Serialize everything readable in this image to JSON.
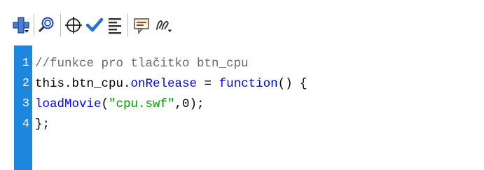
{
  "toolbar": {
    "buttons": [
      {
        "id": "add",
        "icon": "add-statement-icon"
      },
      {
        "id": "find",
        "icon": "find-icon"
      },
      {
        "id": "target",
        "icon": "insert-target-path-icon"
      },
      {
        "id": "check",
        "icon": "check-syntax-icon"
      },
      {
        "id": "format",
        "icon": "auto-format-icon"
      },
      {
        "id": "codehint",
        "icon": "code-hint-icon"
      },
      {
        "id": "debug",
        "icon": "debug-options-icon"
      }
    ]
  },
  "editor": {
    "lines": [
      {
        "number": "1",
        "tokens": [
          {
            "text": "//funkce pro tlačitko btn_cpu",
            "type": "comment"
          }
        ]
      },
      {
        "number": "2",
        "tokens": [
          {
            "text": "this.btn_cpu.",
            "type": "plain"
          },
          {
            "text": "onRelease",
            "type": "keyword"
          },
          {
            "text": " = ",
            "type": "plain"
          },
          {
            "text": "function",
            "type": "keyword"
          },
          {
            "text": "() {",
            "type": "plain"
          }
        ]
      },
      {
        "number": "3",
        "tokens": [
          {
            "text": "loadMovie",
            "type": "keyword"
          },
          {
            "text": "(",
            "type": "plain"
          },
          {
            "text": "\"cpu.swf\"",
            "type": "string"
          },
          {
            "text": ",0);",
            "type": "plain"
          }
        ]
      },
      {
        "number": "4",
        "tokens": [
          {
            "text": "};",
            "type": "plain"
          }
        ]
      }
    ]
  },
  "colors": {
    "gutter": "#1f86dd",
    "keyword": "#0000ff",
    "string": "#009900",
    "comment": "#6a6a6a"
  }
}
